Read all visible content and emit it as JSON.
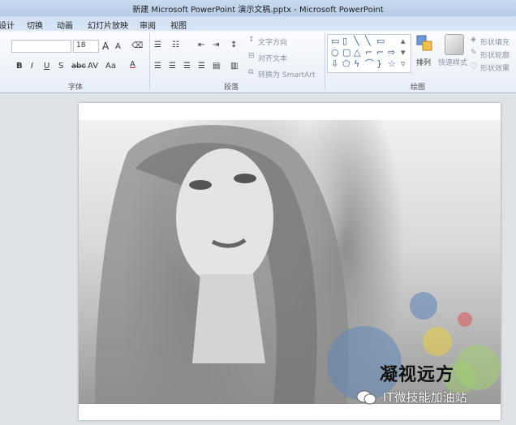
{
  "window": {
    "title": "新建 Microsoft PowerPoint 演示文稿.pptx - Microsoft PowerPoint"
  },
  "tabs": [
    "设计",
    "切换",
    "动画",
    "幻灯片放映",
    "审阅",
    "视图"
  ],
  "ribbon": {
    "font": {
      "size_value": "18",
      "grow": "A",
      "shrink": "A",
      "bold": "B",
      "italic": "I",
      "underline": "U",
      "shadow": "S",
      "strike": "abc",
      "spacing": "AV",
      "case": "Aa",
      "color": "A",
      "group_label": "字体"
    },
    "paragraph": {
      "text_direction": "文字方向",
      "align_text": "对齐文本",
      "smartart": "转换为 SmartArt",
      "group_label": "段落"
    },
    "drawing": {
      "arrange": "排列",
      "quick_styles": "快速样式",
      "shape_fill": "形状填充",
      "shape_outline": "形状轮廓",
      "shape_effects": "形状效果",
      "group_label": "绘图"
    }
  },
  "slide": {
    "caption": "凝视远方",
    "watermark": "IT微技能加油站"
  },
  "colors": {
    "titlebar": "#c4d8ef",
    "ribbon": "#f4f7fb",
    "slide_bg": "#ffffff",
    "bubble_blue": "#5f86b8",
    "bubble_yellow": "#e2cf4a",
    "bubble_green": "#9fd16a",
    "bubble_red": "#d9535a"
  }
}
